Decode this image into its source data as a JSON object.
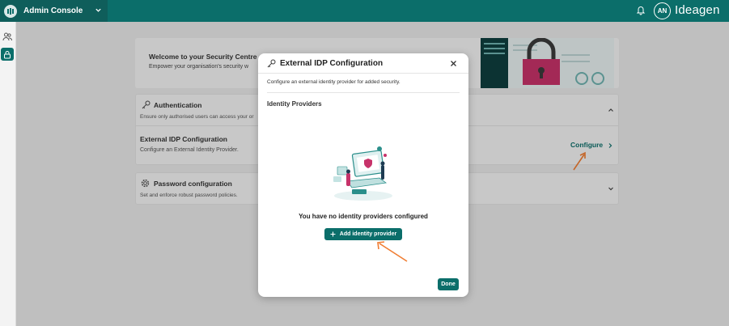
{
  "topbar": {
    "app_title": "Admin Console",
    "avatar_initials": "AN",
    "brand": "Ideagen"
  },
  "welcome": {
    "title": "Welcome to your Security Centre",
    "subtitle": "Empower your organisation's security w"
  },
  "auth": {
    "title": "Authentication",
    "subtitle": "Ensure only authorised users can access your or",
    "idp_title": "External IDP Configuration",
    "idp_subtitle": "Configure an External Identity Provider.",
    "configure_label": "Configure"
  },
  "password": {
    "title": "Password configuration",
    "subtitle": "Set and enforce robust password policies."
  },
  "modal": {
    "title": "External IDP Configuration",
    "description": "Configure an external identity provider for added security.",
    "section_title": "Identity Providers",
    "empty_text": "You have no identity providers configured",
    "add_button": "Add identity provider",
    "done_button": "Done"
  },
  "colors": {
    "accent": "#0b6e6a",
    "annotation_arrow": "#f07d32"
  }
}
